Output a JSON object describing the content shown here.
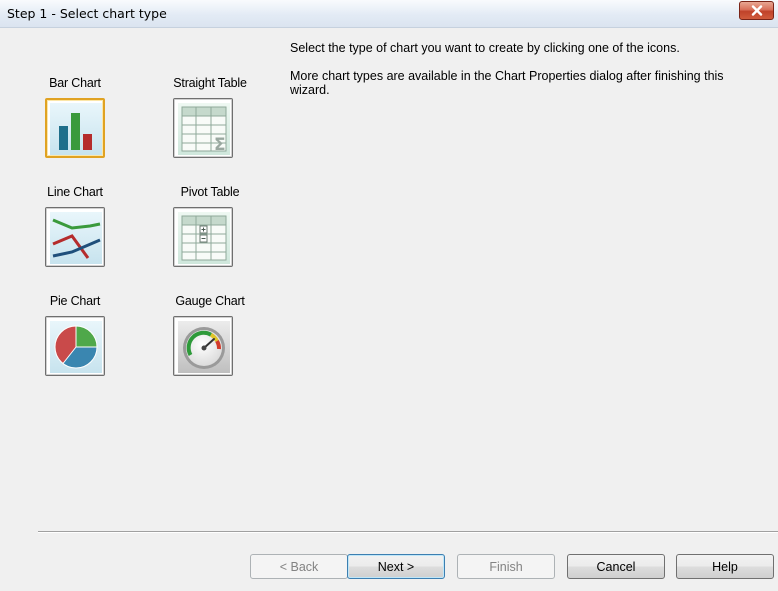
{
  "window": {
    "title": "Step 1 - Select chart type",
    "close_icon": "close-icon"
  },
  "chart_types": [
    {
      "label": "Bar Chart",
      "icon": "bar-chart-icon",
      "selected": true
    },
    {
      "label": "Straight Table",
      "icon": "straight-table-icon",
      "selected": false
    },
    {
      "label": "Line Chart",
      "icon": "line-chart-icon",
      "selected": false
    },
    {
      "label": "Pivot Table",
      "icon": "pivot-table-icon",
      "selected": false
    },
    {
      "label": "Pie Chart",
      "icon": "pie-chart-icon",
      "selected": false
    },
    {
      "label": "Gauge Chart",
      "icon": "gauge-chart-icon",
      "selected": false
    }
  ],
  "description": {
    "line1": "Select the type of chart you want to create by clicking  one of the icons.",
    "line2": "More chart types are available in the Chart Properties dialog after finishing this wizard."
  },
  "buttons": {
    "back": {
      "label": "< Back",
      "enabled": false
    },
    "next": {
      "label": "Next >",
      "enabled": true
    },
    "finish": {
      "label": "Finish",
      "enabled": false
    },
    "cancel": {
      "label": "Cancel",
      "enabled": true
    },
    "help": {
      "label": "Help",
      "enabled": true
    }
  },
  "colors": {
    "selection_border": "#e0a222",
    "title_bar": "#dbe4f0",
    "close_button": "#c0422a"
  }
}
